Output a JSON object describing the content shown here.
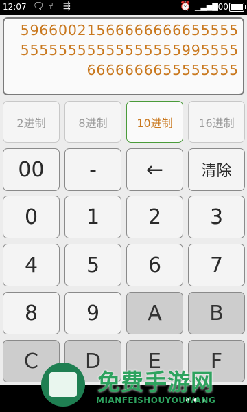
{
  "status_bar": {
    "time": "12:07",
    "icons": [
      "message-icon",
      "usb-connect-icon",
      "usb-icon",
      "alarm-icon",
      "signal-icon"
    ],
    "battery_text": "100"
  },
  "display": {
    "value": "59660021566666666655555555555555555555559955556666666655555555"
  },
  "base_tabs": [
    {
      "label": "2进制",
      "active": false
    },
    {
      "label": "8进制",
      "active": false
    },
    {
      "label": "10进制",
      "active": true
    },
    {
      "label": "16进制",
      "active": false
    }
  ],
  "keys": {
    "row1": [
      "00",
      "-",
      "←",
      "清除"
    ],
    "row2": [
      "0",
      "1",
      "2",
      "3"
    ],
    "row3": [
      "4",
      "5",
      "6",
      "7"
    ],
    "row4": [
      "8",
      "9",
      "A",
      "B"
    ],
    "row5": [
      "C",
      "D",
      "E",
      "F"
    ]
  },
  "watermark": {
    "title": "免费手游网",
    "subtitle": "MIANFEISHOUYOUWANG"
  },
  "nav_bar": {
    "dots": "•••"
  }
}
